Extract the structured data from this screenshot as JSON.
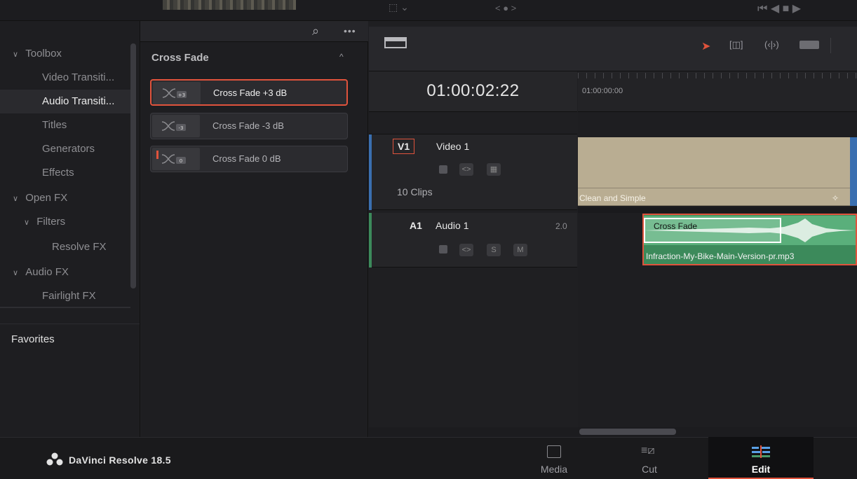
{
  "toolbar": {
    "view_label": "< ● >"
  },
  "sidebar": {
    "items": [
      {
        "label": "Toolbox",
        "expandable": true
      },
      {
        "label": "Video Transiti...",
        "expandable": false
      },
      {
        "label": "Audio Transiti...",
        "expandable": false,
        "selected": true
      },
      {
        "label": "Titles",
        "expandable": false
      },
      {
        "label": "Generators",
        "expandable": false
      },
      {
        "label": "Effects",
        "expandable": false
      },
      {
        "label": "Open FX",
        "expandable": true
      },
      {
        "label": "Filters",
        "expandable": true
      },
      {
        "label": "Resolve FX",
        "expandable": false
      },
      {
        "label": "Audio FX",
        "expandable": true
      },
      {
        "label": "Fairlight FX",
        "expandable": false
      }
    ],
    "favorites_label": "Favorites"
  },
  "transitions": {
    "group_title": "Cross Fade",
    "items": [
      {
        "label": "Cross Fade +3 dB",
        "badge": "+3",
        "selected": true
      },
      {
        "label": "Cross Fade -3 dB",
        "badge": "-3",
        "selected": false
      },
      {
        "label": "Cross Fade 0 dB",
        "badge": "0",
        "selected": false
      }
    ]
  },
  "timeline": {
    "timecode": "01:00:02:22",
    "ruler_label": "01:00:00:00",
    "tracks": {
      "video": {
        "tag": "V1",
        "name": "Video 1",
        "clips_count": "10 Clips",
        "clip_label": "Clean and Simple",
        "color": "#3a6fb0"
      },
      "audio": {
        "tag": "A1",
        "name": "Audio 1",
        "channels": "2.0",
        "clip_label": "Infraction-My-Bike-Main-Version-pr.mp3",
        "transition_label": "Cross Fade",
        "color": "#3c8a5b",
        "solo": "S",
        "mute": "M"
      }
    }
  },
  "footer": {
    "app_name": "DaVinci Resolve 18.5",
    "pages": [
      {
        "label": "Media",
        "icon": "media-icon",
        "active": false
      },
      {
        "label": "Cut",
        "icon": "cut-icon",
        "active": false
      },
      {
        "label": "Edit",
        "icon": "edit-icon",
        "active": true
      }
    ]
  },
  "colors": {
    "accent": "#e0533c",
    "video_clip": "#b9ad92",
    "audio_clip": "#3c8a5b"
  }
}
